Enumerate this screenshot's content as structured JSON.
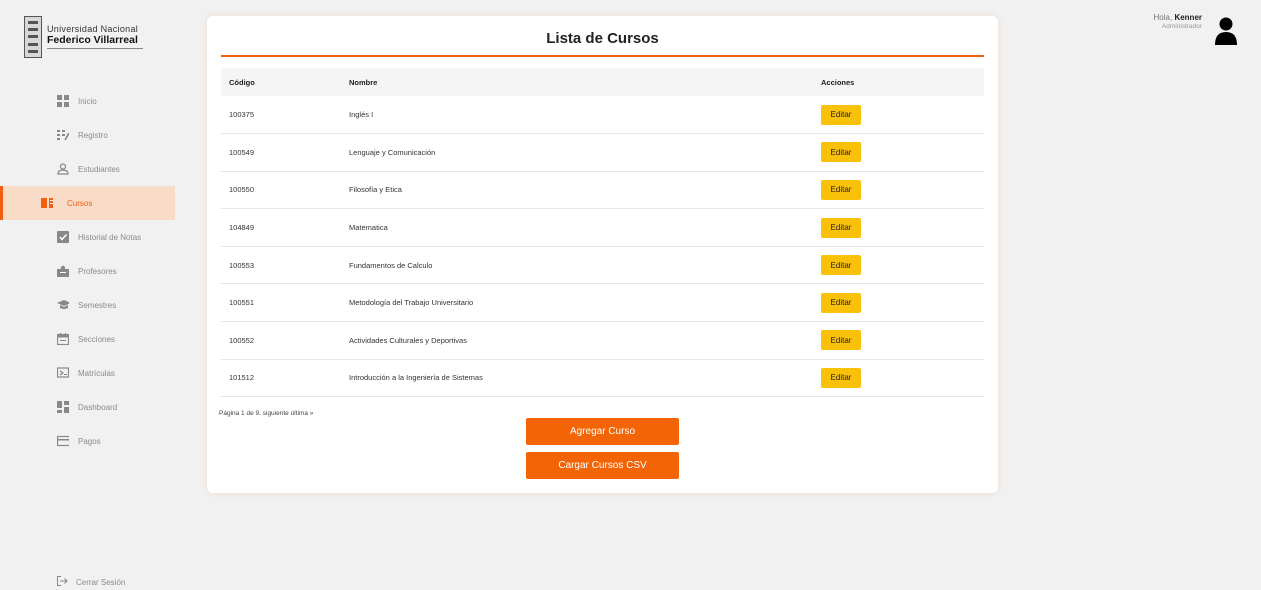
{
  "brand": {
    "line1": "Universidad Nacional",
    "line2": "Federico Villarreal"
  },
  "sidebar": {
    "items": [
      {
        "label": "Inicio",
        "icon": "grid-icon"
      },
      {
        "label": "Registro",
        "icon": "register-icon"
      },
      {
        "label": "Estudiantes",
        "icon": "user-icon"
      },
      {
        "label": "Cursos",
        "icon": "book-icon",
        "active": true
      },
      {
        "label": "Historial de Notas",
        "icon": "check-icon"
      },
      {
        "label": "Profesores",
        "icon": "teacher-icon"
      },
      {
        "label": "Semestres",
        "icon": "graduation-cap-icon"
      },
      {
        "label": "Secciones",
        "icon": "calendar-icon"
      },
      {
        "label": "Matrículas",
        "icon": "enrollment-icon"
      },
      {
        "label": "Dashboard",
        "icon": "dashboard-icon"
      },
      {
        "label": "Pagos",
        "icon": "card-icon"
      }
    ],
    "logout": "Cerrar Sesión"
  },
  "user": {
    "greeting": "Hola,",
    "name": "Kenner",
    "role": "Administrador"
  },
  "main": {
    "title": "Lista de Cursos",
    "columns": [
      "Código",
      "Nombre",
      "Acciones"
    ],
    "edit_label": "Editar",
    "rows": [
      {
        "code": "100375",
        "name": "Inglés I"
      },
      {
        "code": "100549",
        "name": "Lenguaje y Comunicación"
      },
      {
        "code": "100550",
        "name": "Filosofía y Etica"
      },
      {
        "code": "104849",
        "name": "Matematica"
      },
      {
        "code": "100553",
        "name": "Fundamentos de Calculo"
      },
      {
        "code": "100551",
        "name": "Metodología del Trabajo Universitario"
      },
      {
        "code": "100552",
        "name": "Actividades Culturales y Deportivas"
      },
      {
        "code": "101512",
        "name": "Introducción a la Ingeniería de Sistemas"
      }
    ],
    "pagination": {
      "text": "Página 1 de 9.",
      "next": "siguiente",
      "last": "última »"
    },
    "add_button": "Agregar Curso",
    "csv_button": "Cargar Cursos CSV"
  },
  "colors": {
    "accent": "#f26406",
    "edit_button": "#f9c10a",
    "active_bg": "#f9dcc7"
  }
}
